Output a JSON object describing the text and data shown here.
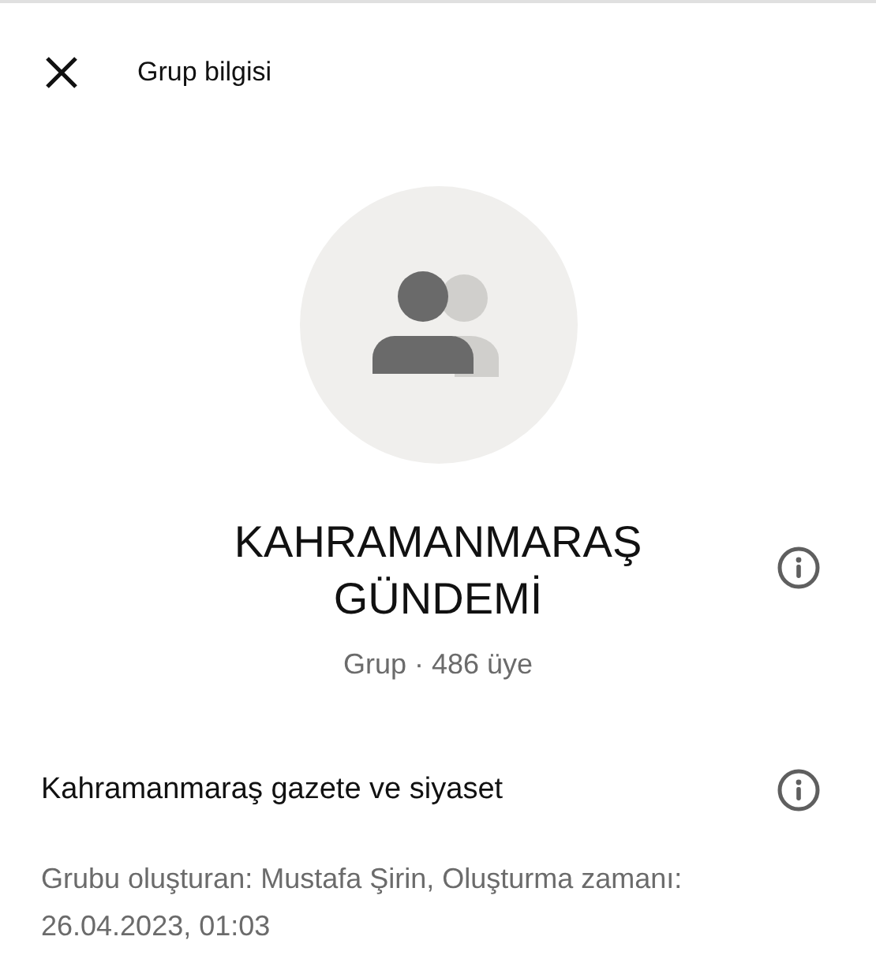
{
  "header": {
    "title": "Grup bilgisi"
  },
  "group": {
    "name": "KAHRAMANMARAŞ GÜNDEMİ",
    "subtitle": "Grup · 486 üye"
  },
  "description": {
    "text": "Kahramanmaraş gazete ve siyaset",
    "created": "Grubu oluşturan: Mustafa Şirin, Oluşturma zamanı: 26.04.2023, 01:03"
  }
}
